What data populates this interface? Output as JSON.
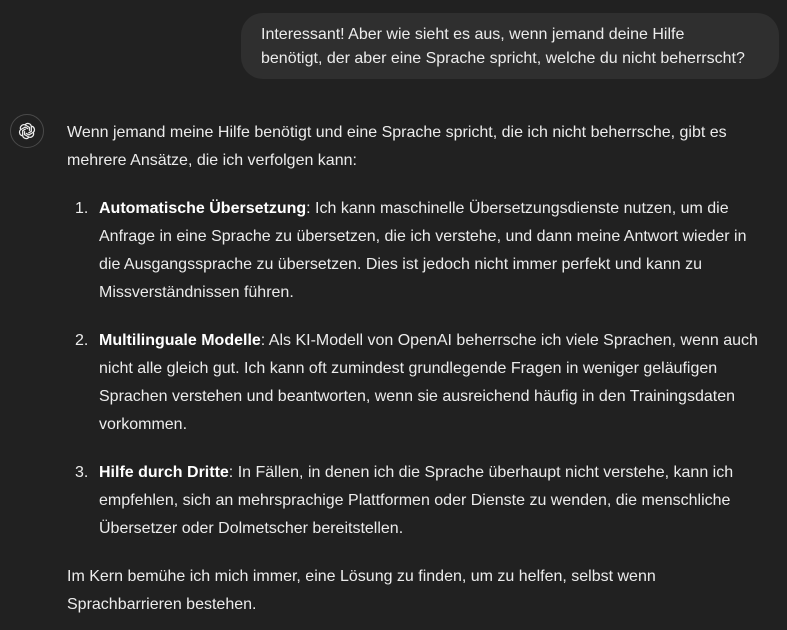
{
  "user_message": {
    "lines": [
      "Interessant! Aber wie sieht es aus, wenn jemand deine Hilfe",
      "benötigt, der aber eine Sprache spricht, welche du nicht beherrscht?"
    ]
  },
  "assistant": {
    "avatar_icon": "openai-logo-icon",
    "intro_lines": [
      "Wenn jemand meine Hilfe benötigt und eine Sprache spricht, die ich nicht beherrsche, gibt es",
      "mehrere Ansätze, die ich verfolgen kann:"
    ],
    "list": [
      {
        "number": "1.",
        "title": "Automatische Übersetzung",
        "first_line_rest": ": Ich kann maschinelle Übersetzungsdienste nutzen, um die",
        "lines": [
          "Anfrage in eine Sprache zu übersetzen, die ich verstehe, und dann meine Antwort wieder in",
          "die Ausgangssprache zu übersetzen. Dies ist jedoch nicht immer perfekt und kann zu",
          "Missverständnissen führen."
        ]
      },
      {
        "number": "2.",
        "title": "Multilinguale Modelle",
        "first_line_rest": ": Als KI-Modell von OpenAI beherrsche ich viele Sprachen, wenn auch",
        "lines": [
          "nicht alle gleich gut. Ich kann oft zumindest grundlegende Fragen in weniger geläufigen",
          "Sprachen verstehen und beantworten, wenn sie ausreichend häufig in den Trainingsdaten",
          "vorkommen."
        ]
      },
      {
        "number": "3.",
        "title": "Hilfe durch Dritte",
        "first_line_rest": ": In Fällen, in denen ich die Sprache überhaupt nicht verstehe, kann ich",
        "lines": [
          "empfehlen, sich an mehrsprachige Plattformen oder Dienste zu wenden, die menschliche",
          "Übersetzer oder Dolmetscher bereitstellen."
        ]
      }
    ],
    "outro_lines": [
      "Im Kern bemühe ich mich immer, eine Lösung zu finden, um zu helfen, selbst wenn",
      "Sprachbarrieren bestehen."
    ]
  }
}
